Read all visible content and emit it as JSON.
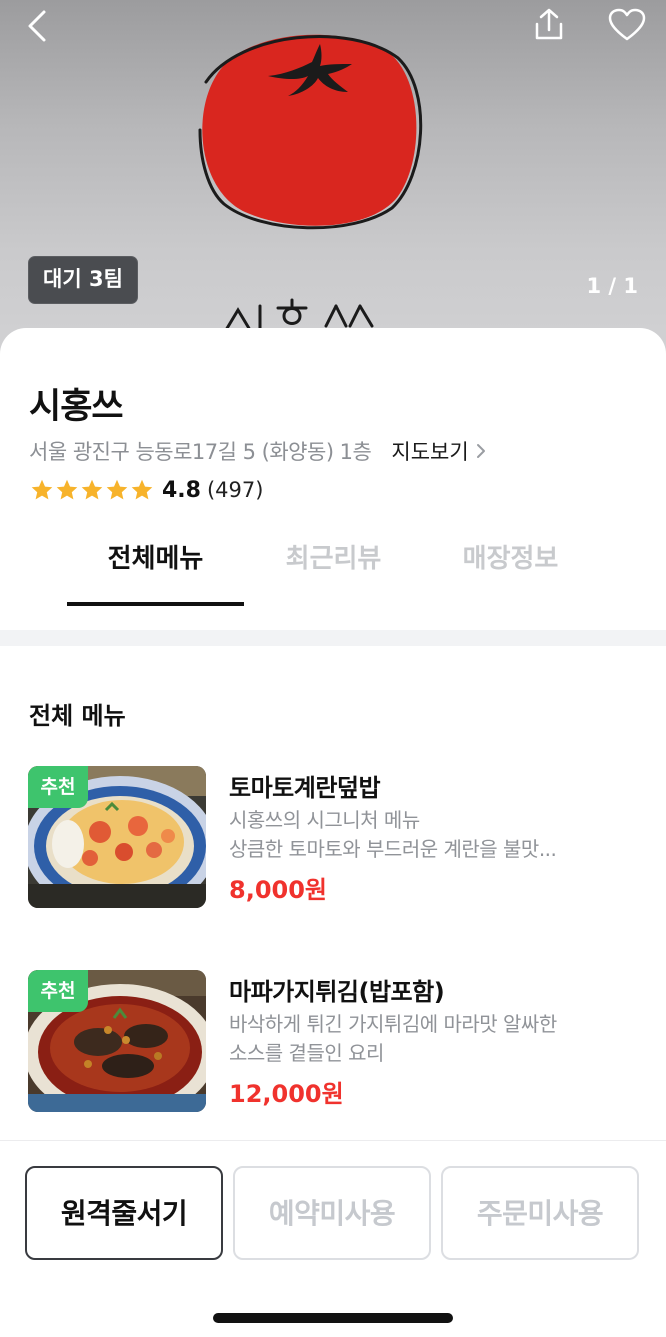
{
  "hero": {
    "wait_badge": "대기 3팀",
    "photo_counter": "1 / 1",
    "back_icon": "chevron-left-icon",
    "share_icon": "share-icon",
    "heart_icon": "heart-icon"
  },
  "store": {
    "name": "시홍쓰",
    "address": "서울 광진구 능동로17길 5 (화양동) 1층",
    "map_link": "지도보기",
    "rating": {
      "score": "4.8",
      "count": "(497)",
      "stars": 5
    }
  },
  "tabs": [
    {
      "label": "전체메뉴",
      "active": true
    },
    {
      "label": "최근리뷰",
      "active": false
    },
    {
      "label": "매장정보",
      "active": false
    }
  ],
  "menu": {
    "title": "전체 메뉴",
    "items": [
      {
        "badge": "추천",
        "name": "토마토계란덮밥",
        "desc_line1": "시홍쓰의 시그니처 메뉴",
        "desc_line2": "상큼한 토마토와 부드러운 계란을 불맛...",
        "price": "8,000원"
      },
      {
        "badge": "추천",
        "name": "마파가지튀김(밥포함)",
        "desc_line1": "바삭하게 튀긴 가지튀김에 마라맛 알싸한",
        "desc_line2": "소스를 곁들인 요리",
        "price": "12,000원"
      }
    ]
  },
  "actions": {
    "remote_queue": "원격줄서기",
    "reservation": "예약미사용",
    "order": "주문미사용"
  },
  "colors": {
    "price": "#f0322d",
    "badge": "#3ec46d",
    "star": "#f7b32b"
  }
}
